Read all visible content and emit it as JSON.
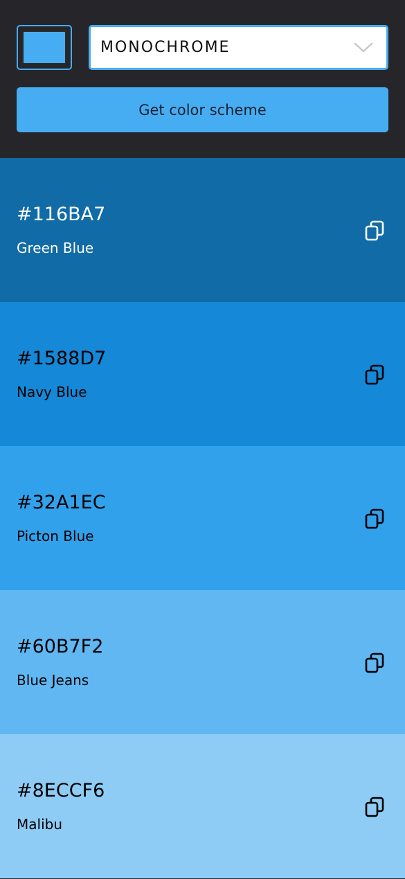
{
  "picker": {
    "selected_color": "#46adf2"
  },
  "mode_select": {
    "value": "MONOCHROME",
    "icon": "chevron-down-icon"
  },
  "get_button": {
    "label": "Get color scheme"
  },
  "colors": [
    {
      "hex": "#116BA7",
      "name": "Green Blue",
      "text_color": "#ffffff",
      "icon": "copy-icon"
    },
    {
      "hex": "#1588D7",
      "name": "Navy Blue",
      "text_color": "#000000",
      "icon": "copy-icon"
    },
    {
      "hex": "#32A1EC",
      "name": "Picton Blue",
      "text_color": "#000000",
      "icon": "copy-icon"
    },
    {
      "hex": "#60B7F2",
      "name": "Blue Jeans",
      "text_color": "#000000",
      "icon": "copy-icon"
    },
    {
      "hex": "#8ECCF6",
      "name": "Malibu",
      "text_color": "#000000",
      "icon": "copy-icon"
    }
  ]
}
